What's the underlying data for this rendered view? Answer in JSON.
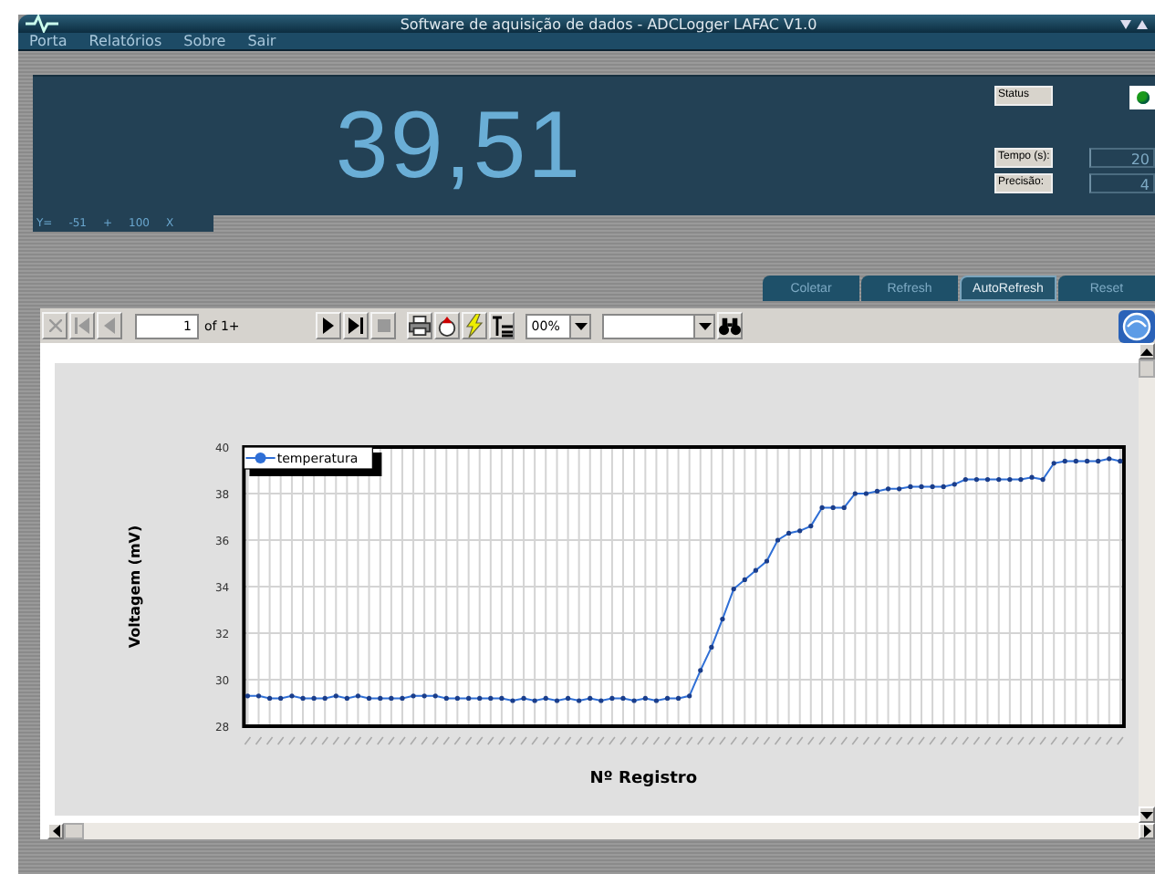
{
  "window": {
    "title": "Software de aquisição de dados - ADCLogger LAFAC V1.0"
  },
  "menu": [
    "Porta",
    "Relatórios",
    "Sobre",
    "Sair"
  ],
  "display": {
    "value": "39,51",
    "formula": [
      "Y=",
      "-51",
      "+",
      "100",
      "X"
    ]
  },
  "status": {
    "label": "Status",
    "on": true
  },
  "fields": [
    {
      "label": "Tempo (s):",
      "value": "20"
    },
    {
      "label": "Precisão:",
      "value": "4"
    }
  ],
  "actions": [
    {
      "label": "Coletar",
      "selected": false
    },
    {
      "label": "Refresh",
      "selected": false
    },
    {
      "label": "AutoRefresh",
      "selected": true
    },
    {
      "label": "Reset",
      "selected": false
    }
  ],
  "report_toolbar": {
    "page": "1",
    "page_count": "of 1+",
    "zoom": "00%"
  },
  "report": {
    "chart_data": {
      "type": "line",
      "grid": true,
      "xlabel": "Nº Registro",
      "ylabel": "Voltagem (mV)",
      "ylim": [
        28,
        40
      ],
      "yticks": [
        28,
        30,
        32,
        34,
        36,
        38,
        40
      ],
      "series": [
        {
          "name": "temperatura",
          "color": "#2f6fd6",
          "values": [
            29.3,
            29.3,
            29.2,
            29.2,
            29.3,
            29.2,
            29.2,
            29.2,
            29.3,
            29.2,
            29.3,
            29.2,
            29.2,
            29.2,
            29.2,
            29.3,
            29.3,
            29.3,
            29.2,
            29.2,
            29.2,
            29.2,
            29.2,
            29.2,
            29.1,
            29.2,
            29.1,
            29.2,
            29.1,
            29.2,
            29.1,
            29.2,
            29.1,
            29.2,
            29.2,
            29.1,
            29.2,
            29.1,
            29.2,
            29.2,
            29.3,
            30.4,
            31.4,
            32.6,
            33.9,
            34.3,
            34.7,
            35.1,
            36.0,
            36.3,
            36.4,
            36.6,
            37.4,
            37.4,
            37.4,
            38.0,
            38.0,
            38.1,
            38.2,
            38.2,
            38.3,
            38.3,
            38.3,
            38.3,
            38.4,
            38.6,
            38.6,
            38.6,
            38.6,
            38.6,
            38.6,
            38.7,
            38.6,
            39.3,
            39.4,
            39.4,
            39.4,
            39.4,
            39.5,
            39.4
          ]
        }
      ]
    }
  }
}
